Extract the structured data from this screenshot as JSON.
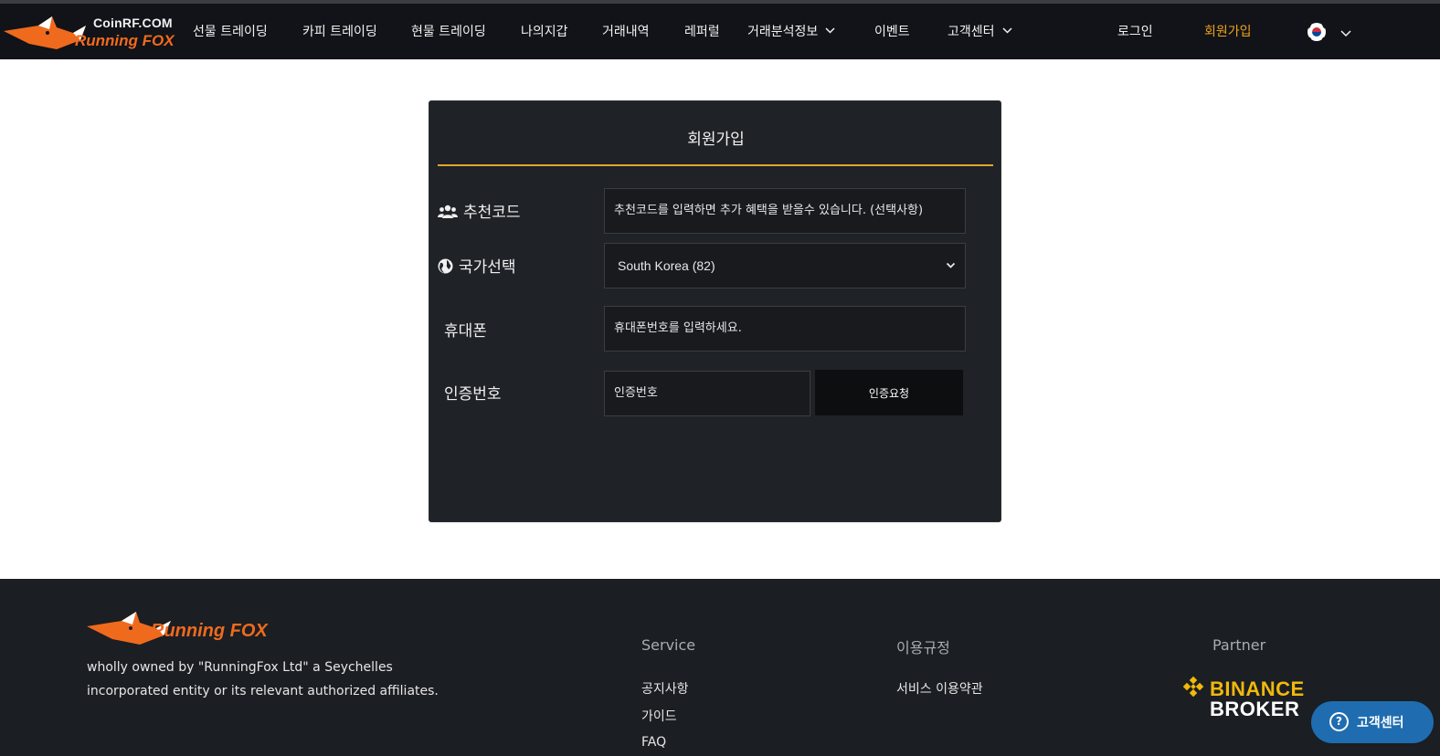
{
  "header": {
    "logo_site": "CoinRF.COM",
    "logo_brand": "Running FOX",
    "nav": [
      {
        "label": "선물 트레이딩"
      },
      {
        "label": "카피 트레이딩"
      },
      {
        "label": "현물 트레이딩"
      },
      {
        "label": "나의지갑"
      },
      {
        "label": "거래내역"
      },
      {
        "label": "레퍼럴"
      },
      {
        "label": "거래분석정보"
      },
      {
        "label": "이벤트"
      },
      {
        "label": "고객센터"
      }
    ],
    "login": "로그인",
    "signup": "회원가입",
    "language_icon": "korea-flag-icon"
  },
  "form": {
    "title": "회원가입",
    "referral_label": "추천코드",
    "referral_placeholder": "추천코드를 입력하면 추가 혜택을 받을수 있습니다. (선택사항)",
    "country_label": "국가선택",
    "country_value": "South Korea (82)",
    "phone_label": "휴대폰",
    "phone_placeholder": "휴대폰번호를 입력하세요.",
    "code_label": "인증번호",
    "code_placeholder": "인증번호",
    "verify_button": "인증요청"
  },
  "footer": {
    "brand": "Running FOX",
    "description": "wholly owned by \"RunningFox Ltd\" a Seychelles incorporated entity or its relevant authorized affiliates.",
    "service_heading": "Service",
    "service_links": [
      "공지사항",
      "가이드",
      "FAQ"
    ],
    "terms_heading": "이용규정",
    "terms_links": [
      "서비스 이용약관"
    ],
    "partner_heading": "Partner",
    "partner_line1": "BINANCE",
    "partner_line2": "BROKER"
  },
  "help_button": "고객센터",
  "colors": {
    "accent": "#e3a52a",
    "brand_orange": "#ef6a1d",
    "header_bg": "#111318",
    "card_bg": "#1f2226",
    "footer_bg": "#1b1e23",
    "help_blue": "#1f6db0"
  }
}
